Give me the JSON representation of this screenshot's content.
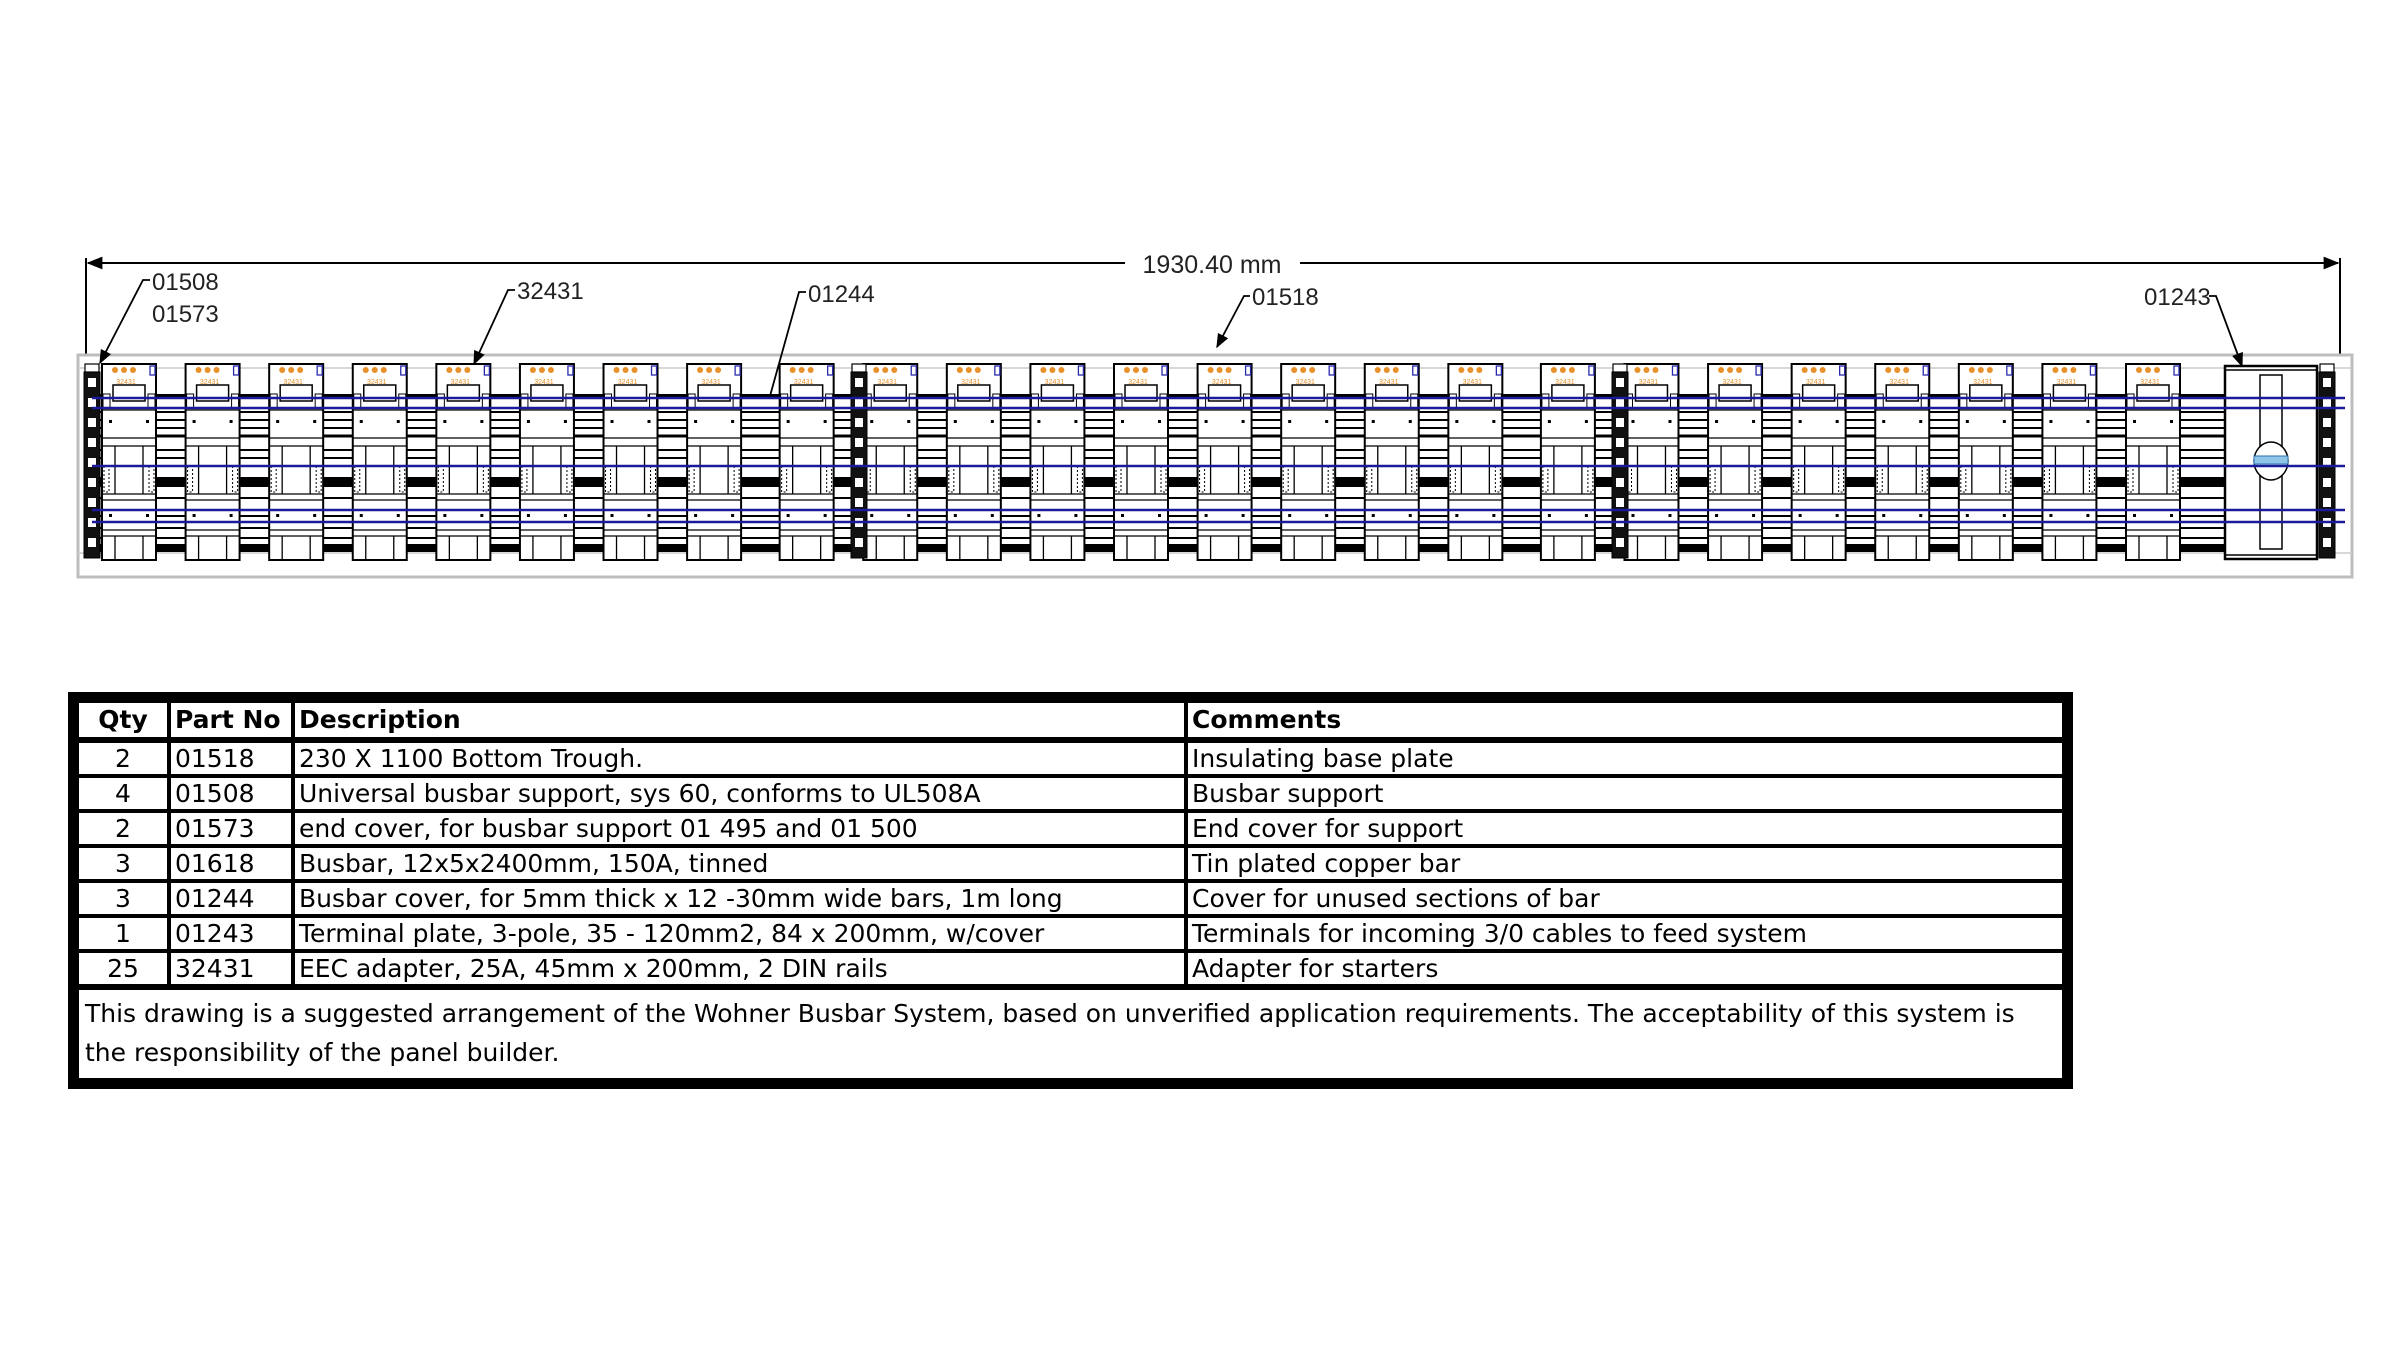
{
  "drawing": {
    "overall_dimension": "1930.40 mm",
    "callouts": [
      {
        "id": "callout-01508-01573",
        "lines": [
          "01508",
          "01573"
        ]
      },
      {
        "id": "callout-32431",
        "lines": [
          "32431"
        ]
      },
      {
        "id": "callout-01244",
        "lines": [
          "01244"
        ]
      },
      {
        "id": "callout-01518",
        "lines": [
          "01518"
        ]
      },
      {
        "id": "callout-01243",
        "lines": [
          "01243"
        ]
      }
    ],
    "adapter_count": 25,
    "adapter_label": "32431",
    "support_count": 4,
    "colors": {
      "busbar_blue": "#1a1a9a",
      "adapter_orange": "#e8912a",
      "line": "#000000",
      "frame_gray": "#bdbdbd",
      "terminal_light_blue": "#8fc6e8"
    }
  },
  "bom": {
    "headers": [
      "Qty",
      "Part No",
      "Description",
      "Comments"
    ],
    "rows": [
      {
        "qty": "2",
        "part": "01518",
        "desc": "230 X 1100 Bottom Trough.",
        "comment": "Insulating base plate"
      },
      {
        "qty": "4",
        "part": "01508",
        "desc": "Universal busbar support, sys 60, conforms to UL508A",
        "comment": "Busbar support"
      },
      {
        "qty": "2",
        "part": "01573",
        "desc": "end cover, for busbar support 01 495 and 01 500",
        "comment": "End cover for support"
      },
      {
        "qty": "3",
        "part": "01618",
        "desc": "Busbar, 12x5x2400mm, 150A, tinned",
        "comment": "Tin plated copper bar"
      },
      {
        "qty": "3",
        "part": "01244",
        "desc": "Busbar cover, for 5mm thick x 12 -30mm wide bars, 1m long",
        "comment": "Cover for unused sections of bar"
      },
      {
        "qty": "1",
        "part": "01243",
        "desc": "Terminal plate, 3-pole, 35 - 120mm2, 84 x 200mm, w/cover",
        "comment": "Terminals for incoming 3/0 cables to feed system"
      },
      {
        "qty": "25",
        "part": "32431",
        "desc": "EEC adapter, 25A, 45mm x 200mm, 2 DIN rails",
        "comment": "Adapter for starters"
      }
    ],
    "note": "This drawing is a suggested arrangement of the Wohner Busbar System, based on unverified application requirements.  The acceptability of this system is the responsibility of the panel builder."
  }
}
